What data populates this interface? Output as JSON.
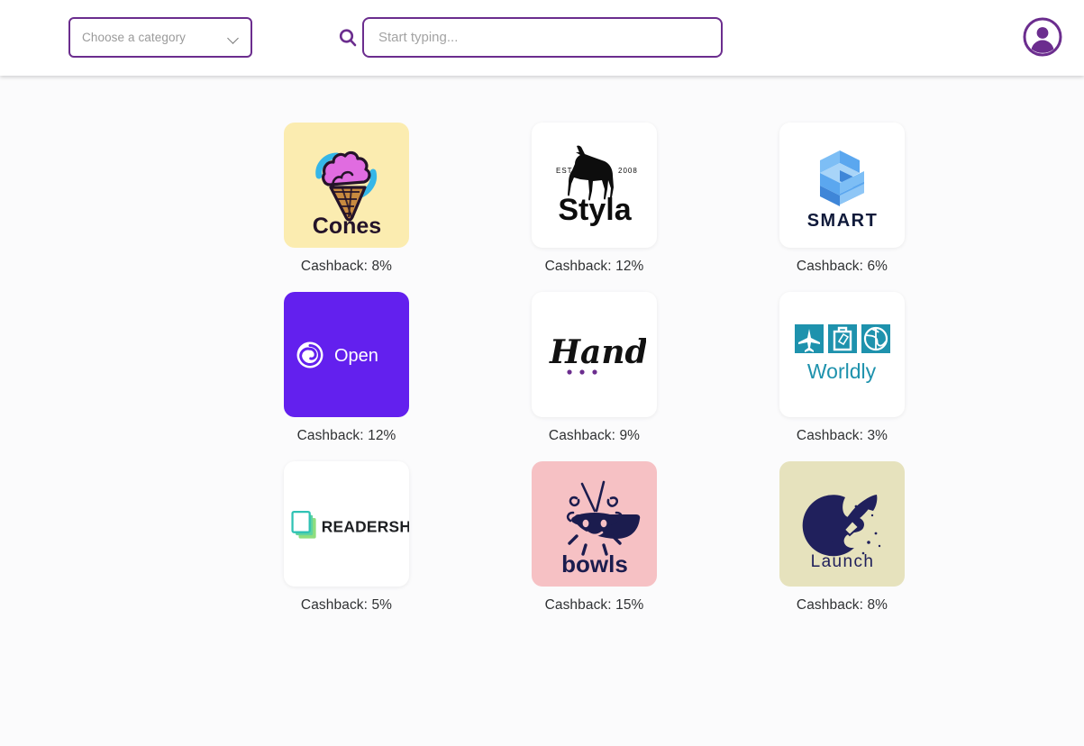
{
  "header": {
    "category_select": {
      "value": "Choose a category",
      "icon": "chevron-down-icon"
    },
    "search": {
      "icon": "search-icon",
      "value": "",
      "placeholder": "Start typing..."
    },
    "avatar": {
      "icon": "user-avatar-icon"
    },
    "accent_color": "#6b2d8e"
  },
  "grid": {
    "cashback_label_prefix": "Cashback:",
    "items": [
      {
        "name": "Cones",
        "logo_text": "Cones",
        "logo_icon": "ice-cream-cone-icon",
        "card_bg": "#fbecb0",
        "cashback": "Cashback: 8%",
        "cashback_value": "8%"
      },
      {
        "name": "Styla",
        "logo_text": "Styla",
        "logo_sub_left": "EST.",
        "logo_sub_right": "2008",
        "logo_icon": "dog-silhouette-icon",
        "card_bg": "#ffffff",
        "cashback": "Cashback: 12%",
        "cashback_value": "12%"
      },
      {
        "name": "SMART",
        "logo_text": "SMART",
        "logo_icon": "isometric-blocks-icon",
        "card_bg": "#ffffff",
        "cashback": "Cashback: 6%",
        "cashback_value": "6%"
      },
      {
        "name": "Open",
        "logo_text": "Open",
        "logo_icon": "spiral-icon",
        "card_bg": "#6320ee",
        "cashback": "Cashback: 12%",
        "cashback_value": "12%"
      },
      {
        "name": "Handy",
        "logo_text": "Handy",
        "logo_icon": "script-wordmark-dots-icon",
        "card_bg": "#ffffff",
        "cashback": "Cashback: 9%",
        "cashback_value": "9%"
      },
      {
        "name": "Worldly",
        "logo_text": "Worldly",
        "logo_icon": "travel-tiles-icon",
        "card_bg": "#ffffff",
        "cashback": "Cashback: 3%",
        "cashback_value": "3%"
      },
      {
        "name": "READERSHIP",
        "logo_text": "READERSHIP",
        "logo_icon": "stacked-books-icon",
        "card_bg": "#ffffff",
        "cashback": "Cashback: 5%",
        "cashback_value": "5%"
      },
      {
        "name": "bowls",
        "logo_text": "bowls",
        "logo_icon": "noodle-bowl-character-icon",
        "card_bg": "#f6c1c4",
        "cashback": "Cashback: 15%",
        "cashback_value": "15%"
      },
      {
        "name": "Launch",
        "logo_text": "Launch",
        "logo_icon": "rocket-moon-icon",
        "card_bg": "#e6e2bd",
        "cashback": "Cashback: 8%",
        "cashback_value": "8%"
      }
    ]
  }
}
